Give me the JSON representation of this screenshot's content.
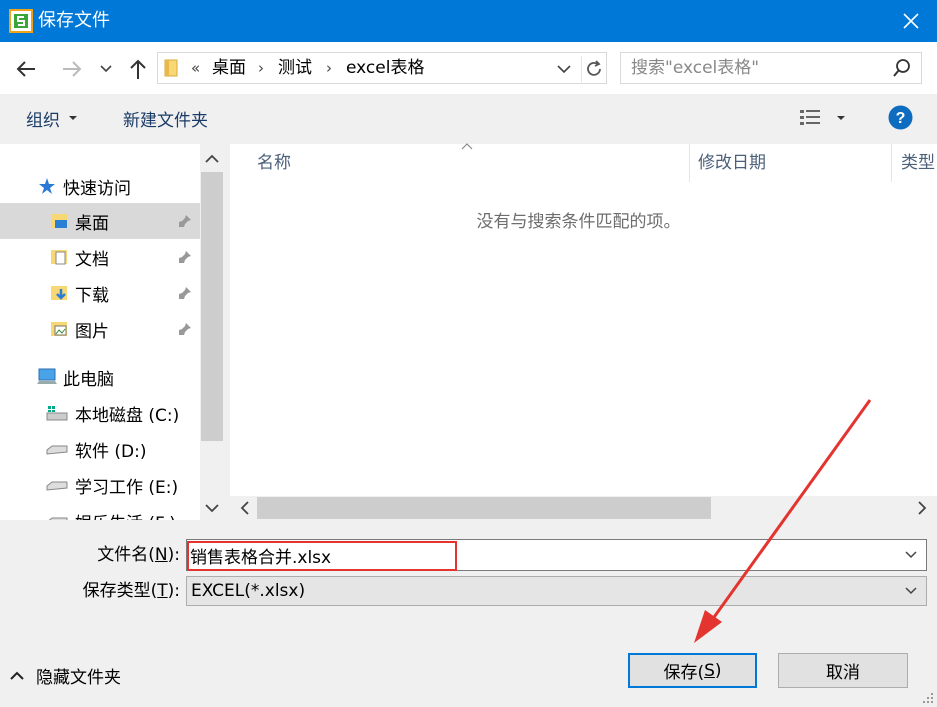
{
  "window": {
    "title": "保存文件",
    "close_glyph": "✕"
  },
  "nav": {
    "address_prefix": "«",
    "breadcrumbs": [
      "桌面",
      "测试",
      "excel表格"
    ],
    "search_placeholder": "搜索\"excel表格\""
  },
  "toolbar": {
    "organize_label": "组织",
    "new_folder_label": "新建文件夹",
    "help_glyph": "?"
  },
  "sidebar": {
    "items": [
      {
        "label": "快速访问",
        "icon": "star-icon"
      },
      {
        "label": "桌面",
        "icon": "desktop-folder-icon",
        "pinned": true,
        "selected": true
      },
      {
        "label": "文档",
        "icon": "documents-folder-icon",
        "pinned": true
      },
      {
        "label": "下载",
        "icon": "downloads-folder-icon",
        "pinned": true
      },
      {
        "label": "图片",
        "icon": "pictures-folder-icon",
        "pinned": true
      },
      {
        "label": "此电脑",
        "icon": "computer-icon"
      },
      {
        "label": "本地磁盘 (C:)",
        "icon": "windows-drive-icon"
      },
      {
        "label": "软件 (D:)",
        "icon": "drive-icon"
      },
      {
        "label": "学习工作 (E:)",
        "icon": "drive-icon"
      },
      {
        "label": "娱乐生活 (F:)",
        "icon": "drive-icon"
      }
    ]
  },
  "content": {
    "columns": [
      "名称",
      "修改日期",
      "类型"
    ],
    "empty_message": "没有与搜索条件匹配的项。"
  },
  "form": {
    "filename_label": "文件名(N):",
    "filename_label_prefix": "文件名(",
    "filename_label_key": "N",
    "filename_label_suffix": "):",
    "filename_value": "销售表格合并.xlsx",
    "filetype_label_prefix": "保存类型(",
    "filetype_label_key": "T",
    "filetype_label_suffix": "):",
    "filetype_value": "EXCEL(*.xlsx)"
  },
  "footer": {
    "hide_folders_label": "隐藏文件夹",
    "save_prefix": "保存(",
    "save_key": "S",
    "save_suffix": ")",
    "cancel_label": "取消"
  },
  "colors": {
    "titlebar": "#0078d7",
    "annotation": "#e3342f",
    "help": "#0e6cc0"
  }
}
